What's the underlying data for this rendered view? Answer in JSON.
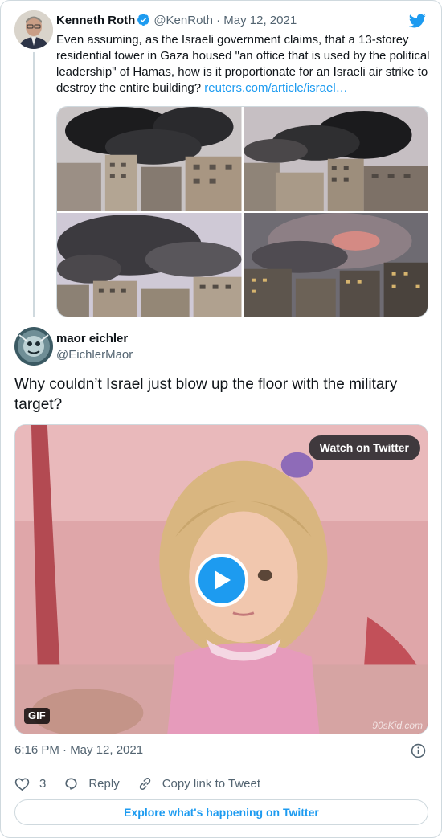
{
  "parent_tweet": {
    "author_name": "Kenneth Roth",
    "author_handle": "@KenRoth",
    "separator": "·",
    "date": "May 12, 2021",
    "text": "Even assuming, as the Israeli government claims, that a 13-storey residential tower in Gaza housed \"an office that is used by the political leadership\" of Hamas, how is it proportionate for an Israeli air strike to destroy the entire building? ",
    "link_text": "reuters.com/article/israel…",
    "icons": [
      "verified-badge-icon",
      "twitter-bird-icon"
    ]
  },
  "reply_tweet": {
    "author_name": "maor eichler",
    "author_handle": "@EichlerMaor",
    "text": "Why couldn’t Israel just blow up the floor with the military target?",
    "media": {
      "watch_label": "Watch on Twitter",
      "gif_label": "GIF",
      "watermark": "90sKid.com"
    },
    "timestamp": "6:16 PM · May 12, 2021"
  },
  "actions": {
    "like_count": "3",
    "reply_label": "Reply",
    "copy_link_label": "Copy link to Tweet"
  },
  "footer": {
    "explore_label": "Explore what's happening on Twitter"
  },
  "colors": {
    "accent": "#1d9bf0",
    "text": "#0f1419",
    "muted": "#536471",
    "border": "#cfd9de"
  }
}
